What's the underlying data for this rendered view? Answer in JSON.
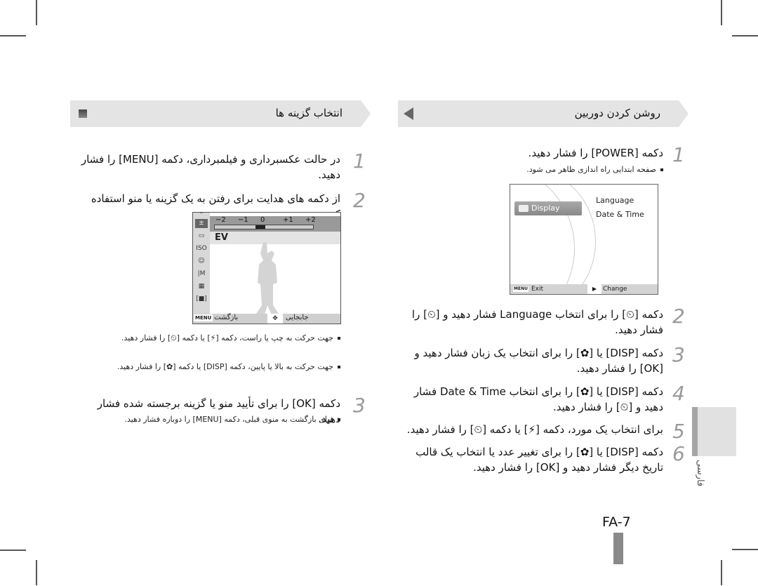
{
  "page": {
    "number": "FA-7",
    "side_tab_label": "فارسی"
  },
  "right_column": {
    "header": "روشن کردن دوربین",
    "steps": [
      {
        "num": "1",
        "text": "دکمه [POWER] را فشار دهید.",
        "bullets": [
          "صفحه ابتدایی راه اندازی ظاهر می شود."
        ]
      },
      {
        "num": "2",
        "text": "دکمه [⏲] را برای انتخاب Language فشار دهید و [⏲] را فشار دهید."
      },
      {
        "num": "3",
        "text": "دکمه [DISP] یا [✿] را برای انتخاب یک زبان فشار دهید و [OK] را فشار دهید."
      },
      {
        "num": "4",
        "text": "دکمه [DISP] یا [✿] را برای انتخاب Date & Time فشار دهید و [⏲] را فشار دهید."
      },
      {
        "num": "5",
        "text": "برای انتخاب یک مورد، دکمه [⚡] یا دکمه [⏲] را فشار دهید."
      },
      {
        "num": "6",
        "text": "دکمه [DISP] یا [✿] را برای تغییر عدد یا انتخاب یک قالب تاریخ دیگر فشار دهید و [OK] را فشار دهید."
      }
    ],
    "screen": {
      "selected_menu": "Display",
      "options": [
        "Language",
        "Date & Time"
      ],
      "footer_left_key": "MENU",
      "footer_left": "Exit",
      "footer_right": "Change"
    }
  },
  "left_column": {
    "header": "انتخاب گزینه ها",
    "steps": [
      {
        "num": "1",
        "text": "در حالت عکسبرداری و فیلمبرداری، دکمه [MENU] را فشار دهید."
      },
      {
        "num": "2",
        "text": "از دکمه های هدایت برای رفتن به یک گزینه یا منو استفاده کنید.",
        "bullets": [
          "جهت حرکت به چپ یا راست، دکمه [⚡] یا دکمه [⏲] را فشار دهید.",
          "جهت حرکت به بالا یا پایین، دکمه [DISP] یا دکمه [✿] را فشار دهید."
        ]
      },
      {
        "num": "3",
        "text": "دکمه [OK] را برای تأیید منو یا گزینه برجسته شده فشار دهید.",
        "bullets": [
          "برای بازگشت به منوی قبلی، دکمه [MENU] را دوباره فشار دهید."
        ]
      }
    ],
    "screen": {
      "ev_label": "EV",
      "ev_ticks": [
        "−2",
        "−1",
        "0",
        "+1",
        "+2"
      ],
      "ev_value": 0,
      "footer_left_key": "MENU",
      "footer_back": "بازگشت",
      "footer_move": "جابجایی",
      "side_icons": [
        "ev-icon",
        "wb-icon",
        "iso-icon",
        "face-detect-off-icon",
        "size-icon",
        "quality-icon",
        "metering-icon"
      ]
    }
  }
}
